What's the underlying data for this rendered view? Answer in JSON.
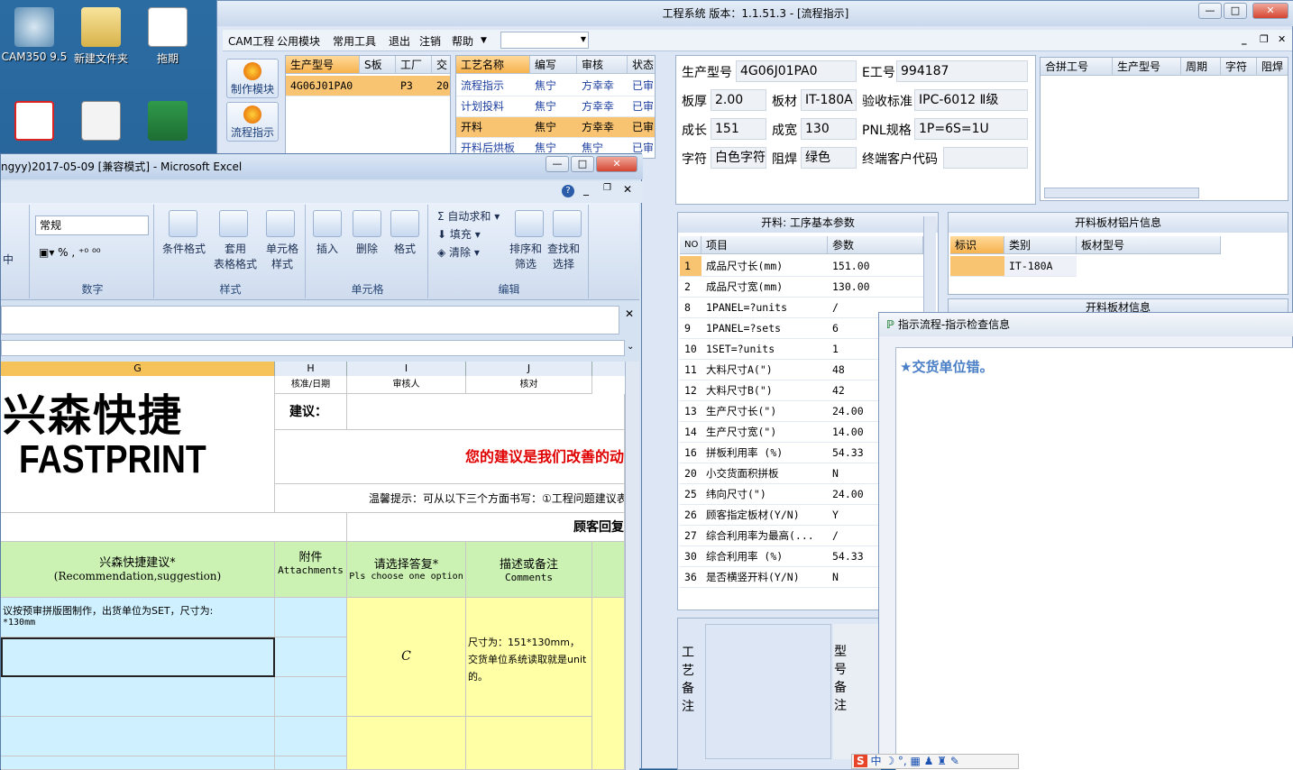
{
  "desktop": {
    "icons": [
      {
        "label": "CAM350 9.5"
      },
      {
        "label": "新建文件夹"
      },
      {
        "label": "拖期"
      },
      {
        "label": ""
      },
      {
        "label": ""
      },
      {
        "label": ""
      }
    ]
  },
  "cam": {
    "title": "工程系统   版本：1.1.51.3 - [流程指示]",
    "menu": [
      "CAM工程",
      "公用模块",
      "常用工具",
      "退出",
      "注销",
      "帮助"
    ],
    "side_buttons": [
      "制作模块",
      "流程指示"
    ],
    "order_grid": {
      "headers": [
        "生产型号",
        "S板",
        "工厂",
        "交"
      ],
      "row": [
        "4G06J01PA0",
        "",
        "P3",
        "20"
      ]
    },
    "process_grid": {
      "headers": [
        "工艺名称",
        "编写",
        "审核",
        "状态"
      ],
      "rows": [
        [
          "流程指示",
          "焦宁",
          "方幸幸",
          "已审"
        ],
        [
          "计划投料",
          "焦宁",
          "方幸幸",
          "已审"
        ],
        [
          "开料",
          "焦宁",
          "方幸幸",
          "已审"
        ],
        [
          "开料后烘板",
          "焦宁",
          "焦宁",
          "已审"
        ]
      ]
    },
    "form": {
      "生产型号": "4G06J01PA0",
      "E工号": "994187",
      "板厚": "2.00",
      "板材": "IT-180A",
      "验收标准": "IPC-6012 Ⅱ级",
      "成长": "151",
      "成宽": "130",
      "PNL规格": "1P=6S=1U",
      "字符": "白色字符",
      "阻焊": "绿色",
      "终端客户代码": ""
    },
    "form_labels": {
      "model": "生产型号",
      "eno": "E工号",
      "thick": "板厚",
      "mat": "板材",
      "std": "验收标准",
      "len": "成长",
      "wid": "成宽",
      "pnl": "PNL规格",
      "char": "字符",
      "mask": "阻焊",
      "cust": "终端客户代码"
    },
    "merge_grid": {
      "headers": [
        "合拼工号",
        "生产型号",
        "周期",
        "字符",
        "阻焊"
      ]
    },
    "params_panel": {
      "title": "开料: 工序基本参数",
      "headers": [
        "NO",
        "项目",
        "参数"
      ],
      "rows": [
        [
          "1",
          "成品尺寸长(mm)",
          "151.00"
        ],
        [
          "2",
          "成品尺寸宽(mm)",
          "130.00"
        ],
        [
          "8",
          "1PANEL=?units",
          "/"
        ],
        [
          "9",
          "1PANEL=?sets",
          "6"
        ],
        [
          "10",
          "1SET=?units",
          "1"
        ],
        [
          "11",
          "大料尺寸A(\")",
          "48"
        ],
        [
          "12",
          "大料尺寸B(\")",
          "42"
        ],
        [
          "13",
          "生产尺寸长(\")",
          "24.00"
        ],
        [
          "14",
          "生产尺寸宽(\")",
          "14.00"
        ],
        [
          "16",
          "拼板利用率 (%)",
          "54.33"
        ],
        [
          "20",
          "小交货面积拼板",
          "N"
        ],
        [
          "25",
          "纬向尺寸(\")",
          "24.00"
        ],
        [
          "26",
          "顾客指定板材(Y/N)",
          "Y"
        ],
        [
          "27",
          "综合利用率为最高(...",
          "/"
        ],
        [
          "30",
          "综合利用率 (%)",
          "54.33"
        ],
        [
          "36",
          "是否横竖开料(Y/N)",
          "N"
        ]
      ]
    },
    "sheet_panel": {
      "title": "开料板材铝片信息",
      "headers": [
        "标识",
        "类别",
        "板材型号"
      ],
      "row": [
        "",
        "IT-180A",
        ""
      ]
    },
    "sheet_panel2_title": "开料板材信息",
    "remark_left": "工艺备注",
    "remark_right": "型号备注"
  },
  "excel": {
    "title": "ngyy)2017-05-09  [兼容模式] - Microsoft Excel",
    "ribbon": {
      "number_format": "常规",
      "groups": [
        "数字",
        "样式",
        "单元格",
        "编辑"
      ],
      "buttons": [
        "条件格式",
        "套用\n表格格式",
        "单元格\n样式",
        "插入",
        "删除",
        "格式",
        "排序和\n筛选",
        "查找和\n选择"
      ],
      "edit_items": [
        "自动求和",
        "填充",
        "清除"
      ],
      "align_label": "中"
    },
    "columns": [
      "G",
      "H",
      "I",
      "J"
    ],
    "sheet": {
      "logo_cn": "兴森快捷",
      "logo_en": "FASTPRINT",
      "suggest_label": "建议：",
      "slogan": "您的建议是我们改善的动",
      "tip": "温馨提示：可从以下三个方面书写：①工程问题建议表",
      "reply": "顾客回复",
      "col1_title": "兴森快捷建议*",
      "col1_sub": "(Recommendation,suggestion)",
      "col2_title": "附件",
      "col2_sub": "Attachments",
      "col3_title": "请选择答复*",
      "col3_sub": "Pls choose one option",
      "col4_title": "描述或备注",
      "col4_sub": "Comments",
      "row_text": "议按预审拼版图制作，出货单位为SET，尺寸为:",
      "row_text2": "*130mm",
      "answer": "C",
      "comment": "尺寸为：151*130mm，交货单位系统读取就是unit的。",
      "top_row_h": "核准/日期",
      "top_row_i": "审核人",
      "top_row_j": "核对"
    }
  },
  "dialog": {
    "title": "指示流程-指示检查信息",
    "message": "★交货单位错。"
  },
  "ime": {
    "label": "中"
  }
}
